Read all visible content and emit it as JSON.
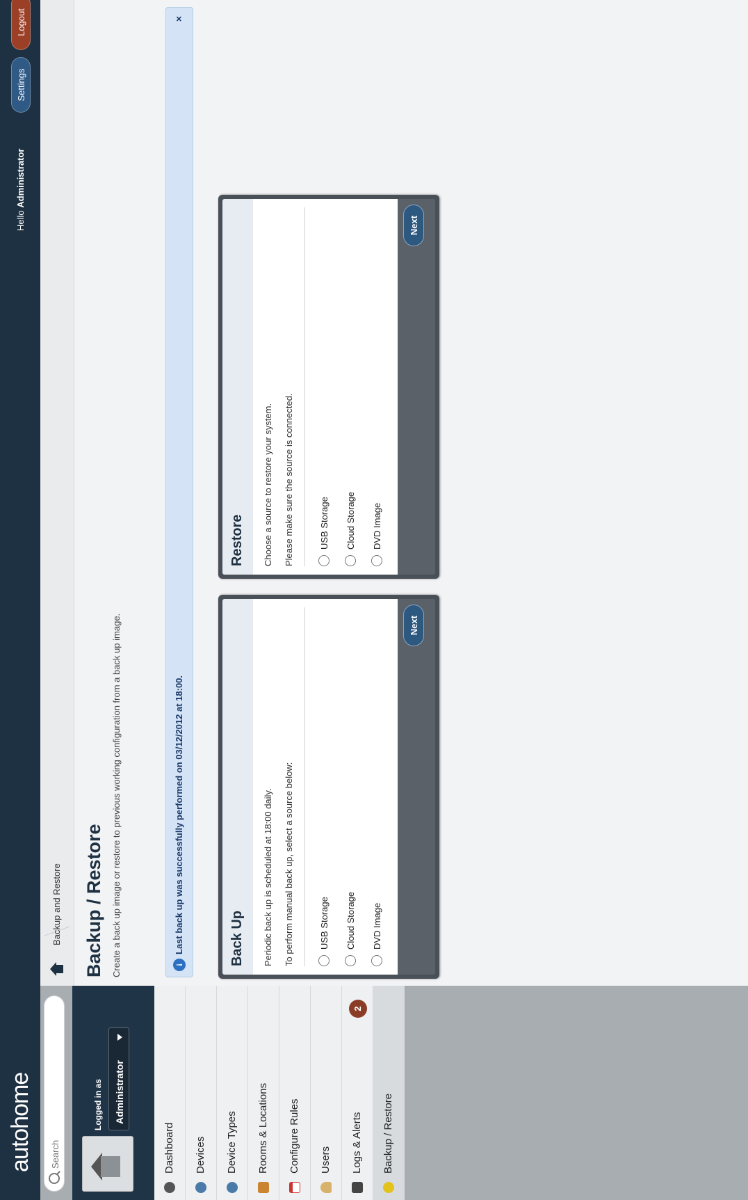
{
  "app": {
    "logo": "autohome"
  },
  "search": {
    "placeholder": "Search"
  },
  "login": {
    "label": "Logged in as",
    "role": "Administrator"
  },
  "nav": [
    {
      "label": "Dashboard",
      "icon": "dashboard-icon"
    },
    {
      "label": "Devices",
      "icon": "devices-icon"
    },
    {
      "label": "Device Types",
      "icon": "device-types-icon"
    },
    {
      "label": "Rooms & Locations",
      "icon": "rooms-icon"
    },
    {
      "label": "Configure Rules",
      "icon": "calendar-icon"
    },
    {
      "label": "Users",
      "icon": "user-icon"
    },
    {
      "label": "Logs & Alerts",
      "icon": "logs-icon",
      "badge": "2"
    },
    {
      "label": "Backup / Restore",
      "icon": "backup-icon"
    }
  ],
  "header": {
    "hello": "Hello",
    "user": "Administrator",
    "settings": "Settings",
    "logout": "Logout"
  },
  "breadcrumb": {
    "current": "Backup and Restore"
  },
  "page": {
    "title": "Backup / Restore",
    "subtitle": "Create a back up image or restore to previous working configuration from a back up image."
  },
  "alert": {
    "message": "Last back up was successfully performed on 03/12/2012 at 18:00.",
    "close": "×"
  },
  "backup": {
    "title": "Back Up",
    "line1": "Periodic back up is scheduled at 18:00 daily.",
    "line2": "To perform manual back up, select a source below:",
    "options": [
      "USB Storage",
      "Cloud Storage",
      "DVD Image"
    ],
    "next": "Next"
  },
  "restore": {
    "title": "Restore",
    "line1": "Choose a source to restore your system.",
    "line2": "Please make sure the source is connected.",
    "options": [
      "USB Storage",
      "Cloud Storage",
      "DVD Image"
    ],
    "next": "Next"
  },
  "colors": {
    "header": "#1e3142",
    "accent": "#2d5880",
    "logout": "#9b3f26",
    "alert_bg": "#d4e3f5"
  }
}
